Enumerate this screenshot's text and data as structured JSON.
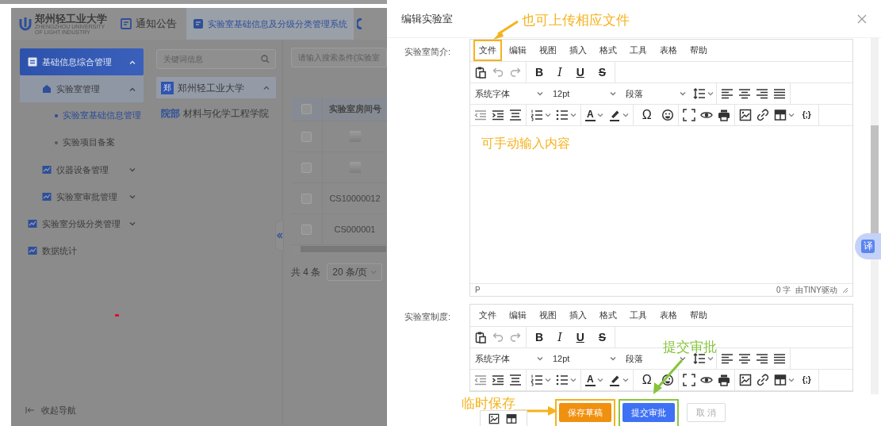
{
  "header": {
    "logo_text": "郑州轻工业大学",
    "logo_subtitle": "ZHENGZHOU UNIVERSITY OF LIGHT INDUSTRY",
    "nav": [
      {
        "label": "通知公告",
        "selected": false
      },
      {
        "label": "实验室基础信息及分级分类管理系统",
        "selected": true
      }
    ]
  },
  "sidebar": {
    "items": [
      {
        "label": "基础信息综合管理",
        "selected": true,
        "expanded": true,
        "children": [
          {
            "label": "实验室管理",
            "selected": false,
            "expanded": true,
            "children": [
              {
                "label": "实验室基础信息管理",
                "selected": true
              },
              {
                "label": "实验项目备案",
                "selected": false
              }
            ]
          },
          {
            "label": "仪器设备管理",
            "selected": false,
            "expanded": false
          },
          {
            "label": "实验室审批管理",
            "selected": false,
            "expanded": false
          }
        ]
      },
      {
        "label": "实验室分级分类管理",
        "selected": false,
        "expanded": false
      },
      {
        "label": "数据统计",
        "selected": false
      }
    ],
    "collapse_label": "收起导航"
  },
  "tree": {
    "search_placeholder": "关键词信息",
    "nodes": [
      {
        "badge": "郑",
        "label": "郑州轻工业大学",
        "expanded": true,
        "children": [
          {
            "tag": "院部",
            "label": "材料与化学工程学院"
          }
        ]
      }
    ]
  },
  "table": {
    "search_placeholder": "请输入搜索条件(实验室",
    "header_checked": false,
    "columns": [
      "实验室房间号"
    ],
    "rows": [
      {
        "checked": false,
        "kind": "blurred"
      },
      {
        "checked": false,
        "kind": "blurred"
      },
      {
        "checked": false,
        "kind": "text",
        "room": "CS10000012"
      },
      {
        "checked": false,
        "kind": "text",
        "room": "CS000001"
      }
    ],
    "total": "共 4 条",
    "page_size": "20 条/页"
  },
  "drawer": {
    "title": "编辑实验室",
    "fields": [
      {
        "label": "实验室简介:",
        "editor": {
          "menubar": [
            {
              "label": "文件",
              "framed": true
            },
            {
              "label": "编辑",
              "framed": false
            },
            {
              "label": "视图",
              "framed": false
            },
            {
              "label": "插入",
              "framed": false
            },
            {
              "label": "格式",
              "framed": false
            },
            {
              "label": "工具",
              "framed": false
            },
            {
              "label": "表格",
              "framed": false
            },
            {
              "label": "帮助",
              "framed": false
            }
          ],
          "font": "系统字体",
          "size": "12pt",
          "block": "段落",
          "glyphs": {
            "bold": "B",
            "italic": "I",
            "underline": "U",
            "strike": "S",
            "font_color": "A",
            "symbol": "Ω",
            "code": "{;}"
          },
          "content": "可手动输入内容",
          "path": "P",
          "word_count": "0 字",
          "powered_by": "由TINY驱动"
        }
      },
      {
        "label": "实验室制度:",
        "editor": {
          "menubar": [
            {
              "label": "文件",
              "framed": false
            },
            {
              "label": "编辑",
              "framed": false
            },
            {
              "label": "视图",
              "framed": false
            },
            {
              "label": "插入",
              "framed": false
            },
            {
              "label": "格式",
              "framed": false
            },
            {
              "label": "工具",
              "framed": false
            },
            {
              "label": "表格",
              "framed": false
            },
            {
              "label": "帮助",
              "framed": false
            }
          ],
          "font": "系统字体",
          "size": "12pt",
          "block": "段落",
          "glyphs": {
            "bold": "B",
            "italic": "I",
            "underline": "U",
            "strike": "S",
            "font_color": "A",
            "symbol": "Ω",
            "code": "{;}"
          }
        }
      }
    ],
    "buttons": [
      {
        "label": "保存草稿",
        "kind": "draft",
        "disabled": false,
        "framed": true
      },
      {
        "label": "提交审批",
        "kind": "submit",
        "disabled": false,
        "framed": true
      },
      {
        "label": "取 消",
        "kind": "cancel",
        "disabled": true
      }
    ]
  },
  "annotations": [
    {
      "text": "也可上传相应文件",
      "color": "#f5b21c"
    },
    {
      "text": "提交审批",
      "color": "#86c43a"
    },
    {
      "text": "临时保存",
      "color": "#f5b21c"
    }
  ],
  "translate_button": {
    "label": "译"
  }
}
